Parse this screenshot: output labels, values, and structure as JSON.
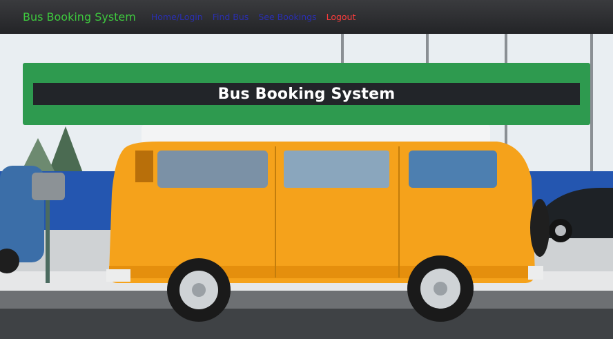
{
  "navbar": {
    "brand": "Bus Booking System",
    "links": [
      {
        "label": "Home/Login"
      },
      {
        "label": "Find Bus"
      },
      {
        "label": "See Bookings"
      },
      {
        "label": "Logout"
      }
    ]
  },
  "hero": {
    "title": "Bus Booking System"
  },
  "colors": {
    "brand": "#3ec83e",
    "nav_link": "#2a2fb0",
    "logout": "#ff3c3c",
    "jumbotron": "#2e9a4f",
    "title_bar": "#222529"
  }
}
